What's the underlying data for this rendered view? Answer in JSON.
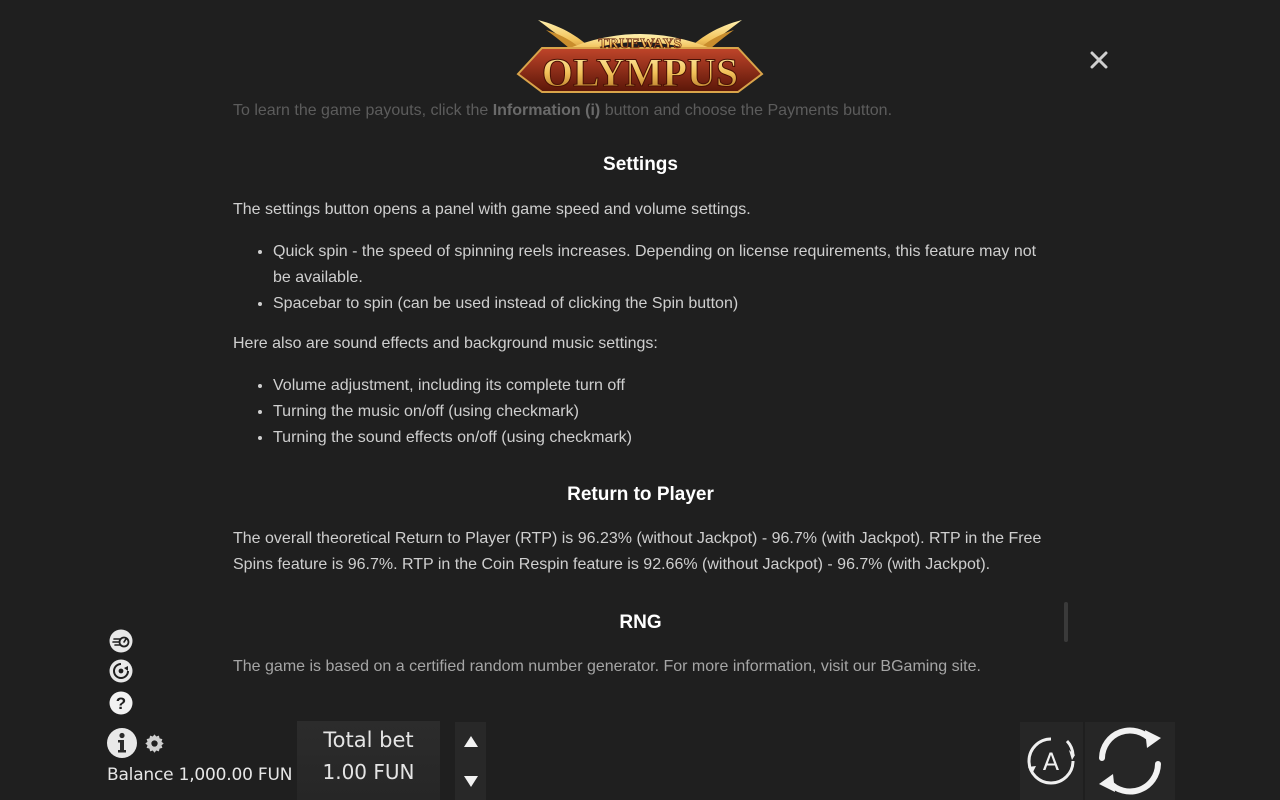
{
  "header": {
    "logo_small": "TRUEWAYS",
    "logo_big": "OLYMPUS"
  },
  "rules": {
    "faded_line_pre": "To learn the game payouts, click the ",
    "faded_line_bold": "Information (i)",
    "faded_line_post": " button and choose the Payments button.",
    "settings": {
      "heading": "Settings",
      "intro": "The settings button opens a panel with game speed and volume settings.",
      "bullets": [
        "Quick spin - the speed of spinning reels increases. Depending on license requirements, this feature may not be available.",
        "Spacebar to spin (can be used instead of clicking the Spin button)"
      ],
      "sound_intro": "Here also are sound effects and background music settings:",
      "sound_bullets": [
        "Volume adjustment, including its complete turn off",
        "Turning the music on/off (using checkmark)",
        "Turning the sound effects on/off (using checkmark)"
      ]
    },
    "rtp": {
      "heading": "Return to Player",
      "text": "The overall theoretical Return to Player (RTP) is 96.23% (without Jackpot) - 96.7% (with Jackpot). RTP in the Free Spins feature is 96.7%. RTP in the Coin Respin feature is 92.66% (without Jackpot) - 96.7% (with Jackpot)."
    },
    "rng": {
      "heading": "RNG",
      "text": "The game is based on a certified random number generator. For more information, visit our BGaming site."
    }
  },
  "footer": {
    "balance": "Balance 1,000.00 FUN",
    "bet_label": "Total bet",
    "bet_value": "1.00 FUN",
    "auto_letter": "A"
  },
  "icons": {
    "close": "close-icon",
    "turbo": "turbo-icon",
    "sound": "sound-icon",
    "help": "help-icon",
    "info": "info-icon",
    "settings": "gear-icon",
    "bet_up": "triangle-up-icon",
    "bet_down": "triangle-down-icon",
    "autoplay": "autoplay-icon",
    "spin": "spin-icon"
  },
  "colors": {
    "background": "#1f1f1f",
    "heading": "#ffffff",
    "body_text": "#cfcfcf",
    "logo_gold": "#f2c25a",
    "logo_red": "#8e2a16"
  }
}
